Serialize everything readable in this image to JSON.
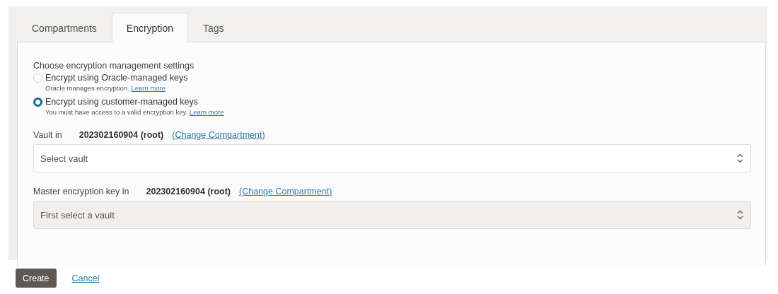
{
  "tabs": [
    {
      "label": "Compartments",
      "selected": false
    },
    {
      "label": "Encryption",
      "selected": true
    },
    {
      "label": "Tags",
      "selected": false
    }
  ],
  "encryption": {
    "heading": "Choose encryption management settings",
    "options": [
      {
        "label": "Encrypt using Oracle-managed keys",
        "description": "Oracle manages encryption.",
        "link": "Learn more",
        "selected": false
      },
      {
        "label": "Encrypt using customer-managed keys",
        "description": "You must have access to a valid encryption key.",
        "link": "Learn more",
        "selected": true
      }
    ],
    "fields": [
      {
        "label": "Vault in",
        "compartment": "202302160904 (root)",
        "link": "(Change Compartment)",
        "placeholder": "Select vault",
        "disabled": false
      },
      {
        "label": "Master encryption key in",
        "compartment": "202302160904 (root)",
        "link": "(Change Compartment)",
        "placeholder": "First select a vault",
        "disabled": true
      }
    ]
  },
  "buttons": [
    {
      "label": "Create",
      "kind": "primary"
    },
    {
      "label": "Cancel",
      "kind": "link"
    }
  ]
}
